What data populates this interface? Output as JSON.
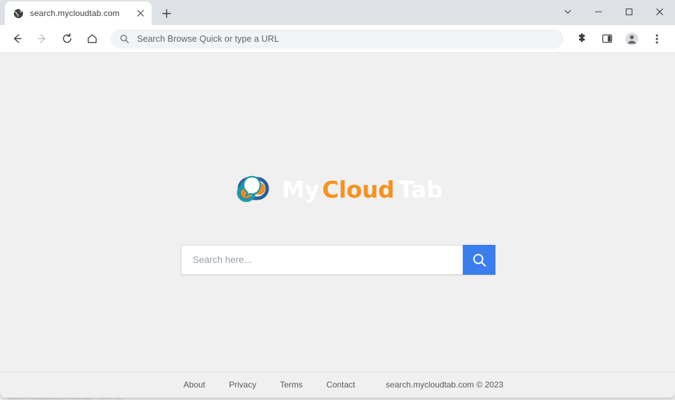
{
  "window": {
    "controls": [
      {
        "name": "tab-search-button",
        "icon": "chevron-down-icon",
        "title": "Search tabs"
      },
      {
        "name": "minimize-button",
        "icon": "minimize-icon",
        "title": "Minimize"
      },
      {
        "name": "maximize-button",
        "icon": "maximize-icon",
        "title": "Maximize"
      },
      {
        "name": "close-button",
        "icon": "close-icon",
        "title": "Close"
      }
    ]
  },
  "tabs": {
    "active": {
      "title": "search.mycloudtab.com",
      "favicon": "globe-icon",
      "close_label": "×"
    },
    "new_tab_label": "+"
  },
  "toolbar": {
    "back_title": "Back",
    "forward_title": "Forward",
    "reload_title": "Reload",
    "home_title": "Home",
    "omnibox": {
      "placeholder": "Search Browse Quick or type a URL",
      "value": "",
      "icon": "search-icon"
    },
    "extensions_title": "Extensions",
    "side_panel_title": "Side panel",
    "profile_title": "Profile",
    "menu_title": "Customize and control Google Chrome"
  },
  "page": {
    "background_color": "#f0f0f0",
    "logo": {
      "icon": "cloud-chat-logo-icon",
      "word_my": "My",
      "word_cloud": "Cloud",
      "word_tab": "Tab",
      "color_my": "#ffffff",
      "color_cloud": "#f59221",
      "color_tab": "#ffffff",
      "cloud_teal": "#1b9aa9",
      "cloud_blue": "#2a5f9e",
      "cloud_orange": "#f58a1f"
    },
    "search": {
      "placeholder": "Search here...",
      "value": "",
      "button_icon": "search-icon",
      "button_color": "#3b7ded"
    },
    "footer": {
      "links": [
        {
          "label": "About"
        },
        {
          "label": "Privacy"
        },
        {
          "label": "Terms"
        },
        {
          "label": "Contact"
        }
      ],
      "copyright": "search.mycloudtab.com © 2023"
    }
  },
  "background_desktop": {
    "ghost_text": "www.mycloudtab.com/contact-r.html?etc",
    "ghost_text_right": "fixed"
  }
}
